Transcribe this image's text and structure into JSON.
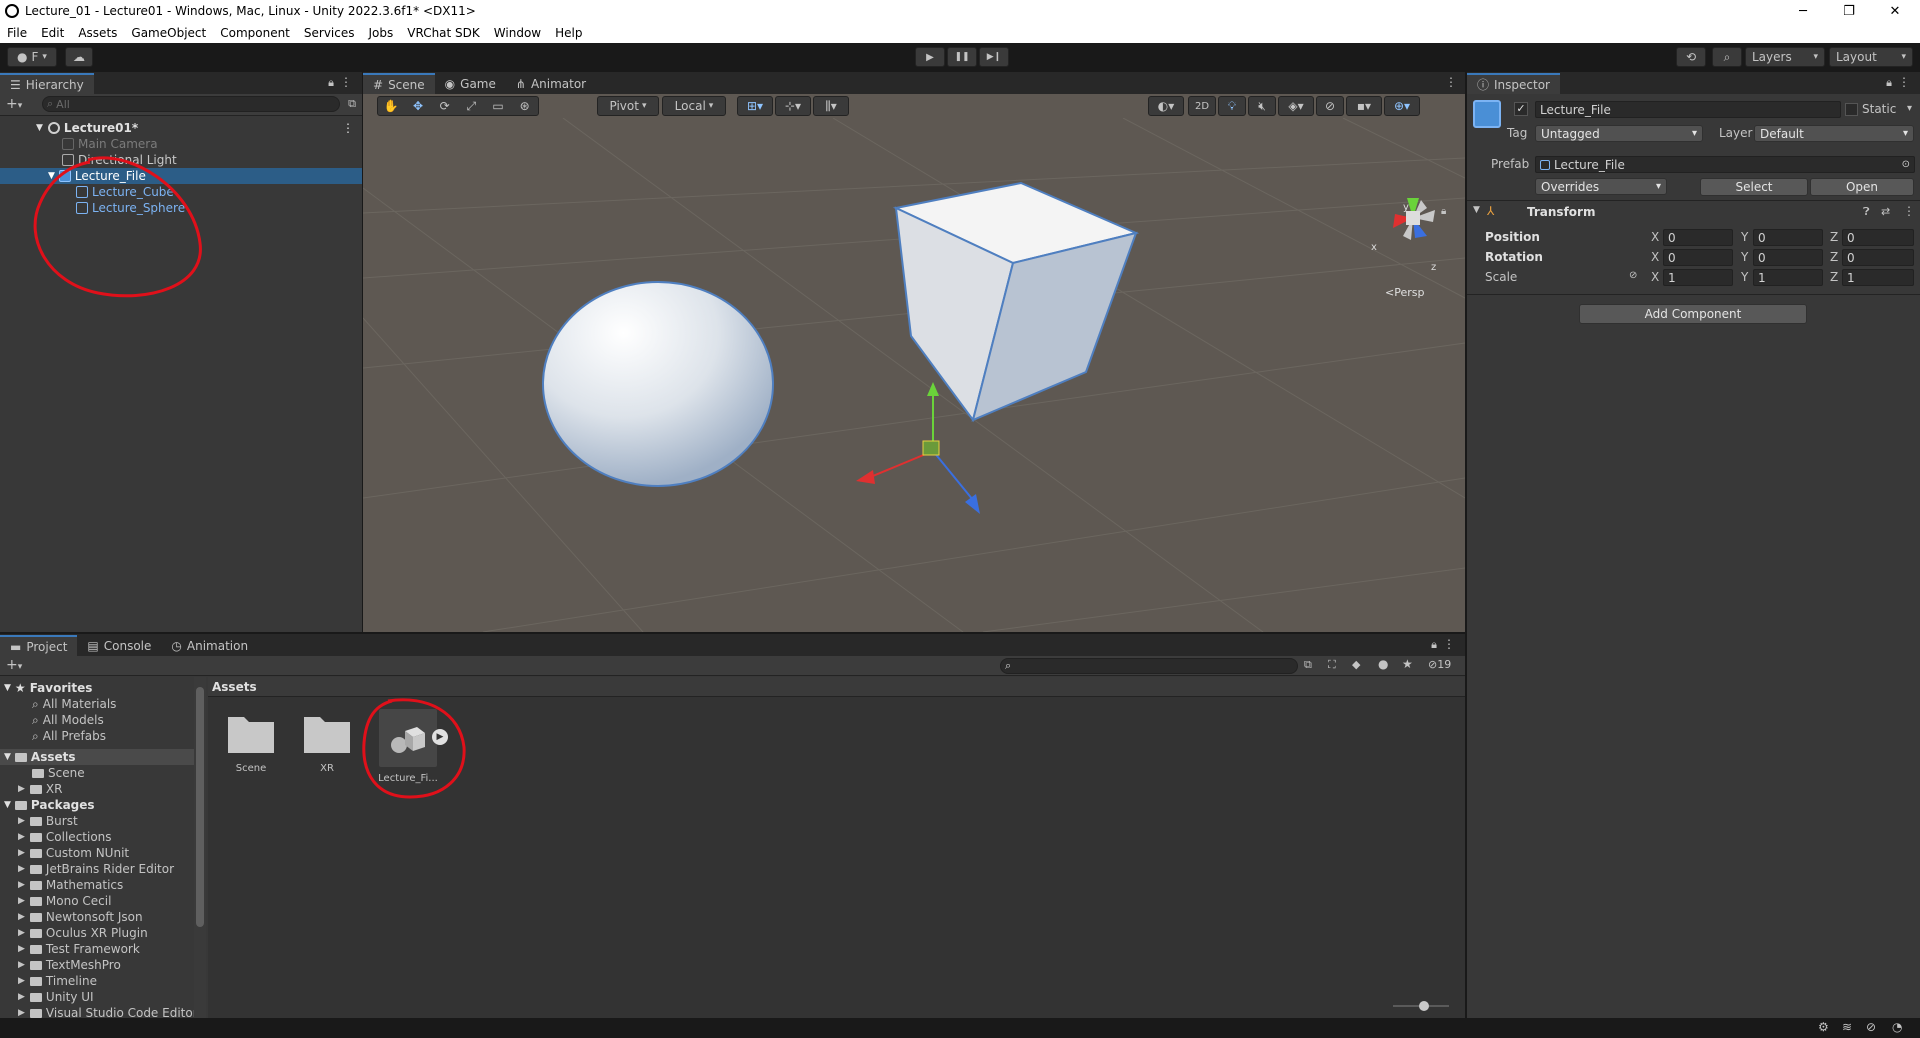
{
  "window": {
    "title": "Lecture_01 - Lecture01 - Windows, Mac, Linux - Unity 2022.3.6f1* <DX11>",
    "minimize": "─",
    "restore": "❐",
    "close": "✕"
  },
  "menu": [
    "File",
    "Edit",
    "Assets",
    "GameObject",
    "Component",
    "Services",
    "Jobs",
    "VRChat SDK",
    "Window",
    "Help"
  ],
  "toolbar": {
    "account": "F",
    "play": "▶",
    "pause": "❚❚",
    "step": "▶❙",
    "layers": "Layers",
    "layout": "Layout"
  },
  "hierarchy": {
    "tab": "Hierarchy",
    "search_placeholder": "All",
    "scene": "Lecture01*",
    "items": [
      {
        "label": "Main Camera",
        "state": "disabled"
      },
      {
        "label": "Directional Light",
        "state": "normal"
      },
      {
        "label": "Lecture_File",
        "state": "selected"
      },
      {
        "label": "Lecture_Cube",
        "state": "prefab"
      },
      {
        "label": "Lecture_Sphere",
        "state": "prefab"
      }
    ]
  },
  "scene_view": {
    "tabs": [
      "Scene",
      "Game",
      "Animator"
    ],
    "pivot": "Pivot",
    "local": "Local",
    "mode_2d": "2D",
    "persp": "Persp",
    "gizmo_y": "y",
    "gizmo_x": "x",
    "gizmo_z": "z"
  },
  "inspector": {
    "tab": "Inspector",
    "object_name": "Lecture_File",
    "static_label": "Static",
    "tag_label": "Tag",
    "tag_value": "Untagged",
    "layer_label": "Layer",
    "layer_value": "Default",
    "prefab_label": "Prefab",
    "prefab_value": "Lecture_File",
    "overrides": "Overrides",
    "select": "Select",
    "open": "Open",
    "transform": {
      "title": "Transform",
      "rows": [
        {
          "label": "Position",
          "x": "0",
          "y": "0",
          "z": "0"
        },
        {
          "label": "Rotation",
          "x": "0",
          "y": "0",
          "z": "0"
        },
        {
          "label": "Scale",
          "x": "1",
          "y": "1",
          "z": "1"
        }
      ],
      "axis_x": "X",
      "axis_y": "Y",
      "axis_z": "Z"
    },
    "add_component": "Add Component"
  },
  "project": {
    "tabs": [
      "Project",
      "Console",
      "Animation"
    ],
    "favorites_title": "Favorites",
    "favorites": [
      "All Materials",
      "All Models",
      "All Prefabs"
    ],
    "assets_title": "Assets",
    "assets_children": [
      "Scene",
      "XR"
    ],
    "packages_title": "Packages",
    "packages": [
      "Burst",
      "Collections",
      "Custom NUnit",
      "JetBrains Rider Editor",
      "Mathematics",
      "Mono Cecil",
      "Newtonsoft Json",
      "Oculus XR Plugin",
      "Test Framework",
      "TextMeshPro",
      "Timeline",
      "Unity UI",
      "Visual Studio Code Editor"
    ],
    "breadcrumb": "Assets",
    "hidden_count": "19",
    "grid_items": [
      {
        "label": "Scene",
        "kind": "folder"
      },
      {
        "label": "XR",
        "kind": "folder"
      },
      {
        "label": "Lecture_Fi...",
        "kind": "prefab"
      }
    ]
  },
  "colors": {
    "selection": "#2c5d87",
    "prefab_text": "#7cb3f3",
    "annotation_red": "#e0101a",
    "scene_bg": "#5e5852"
  }
}
